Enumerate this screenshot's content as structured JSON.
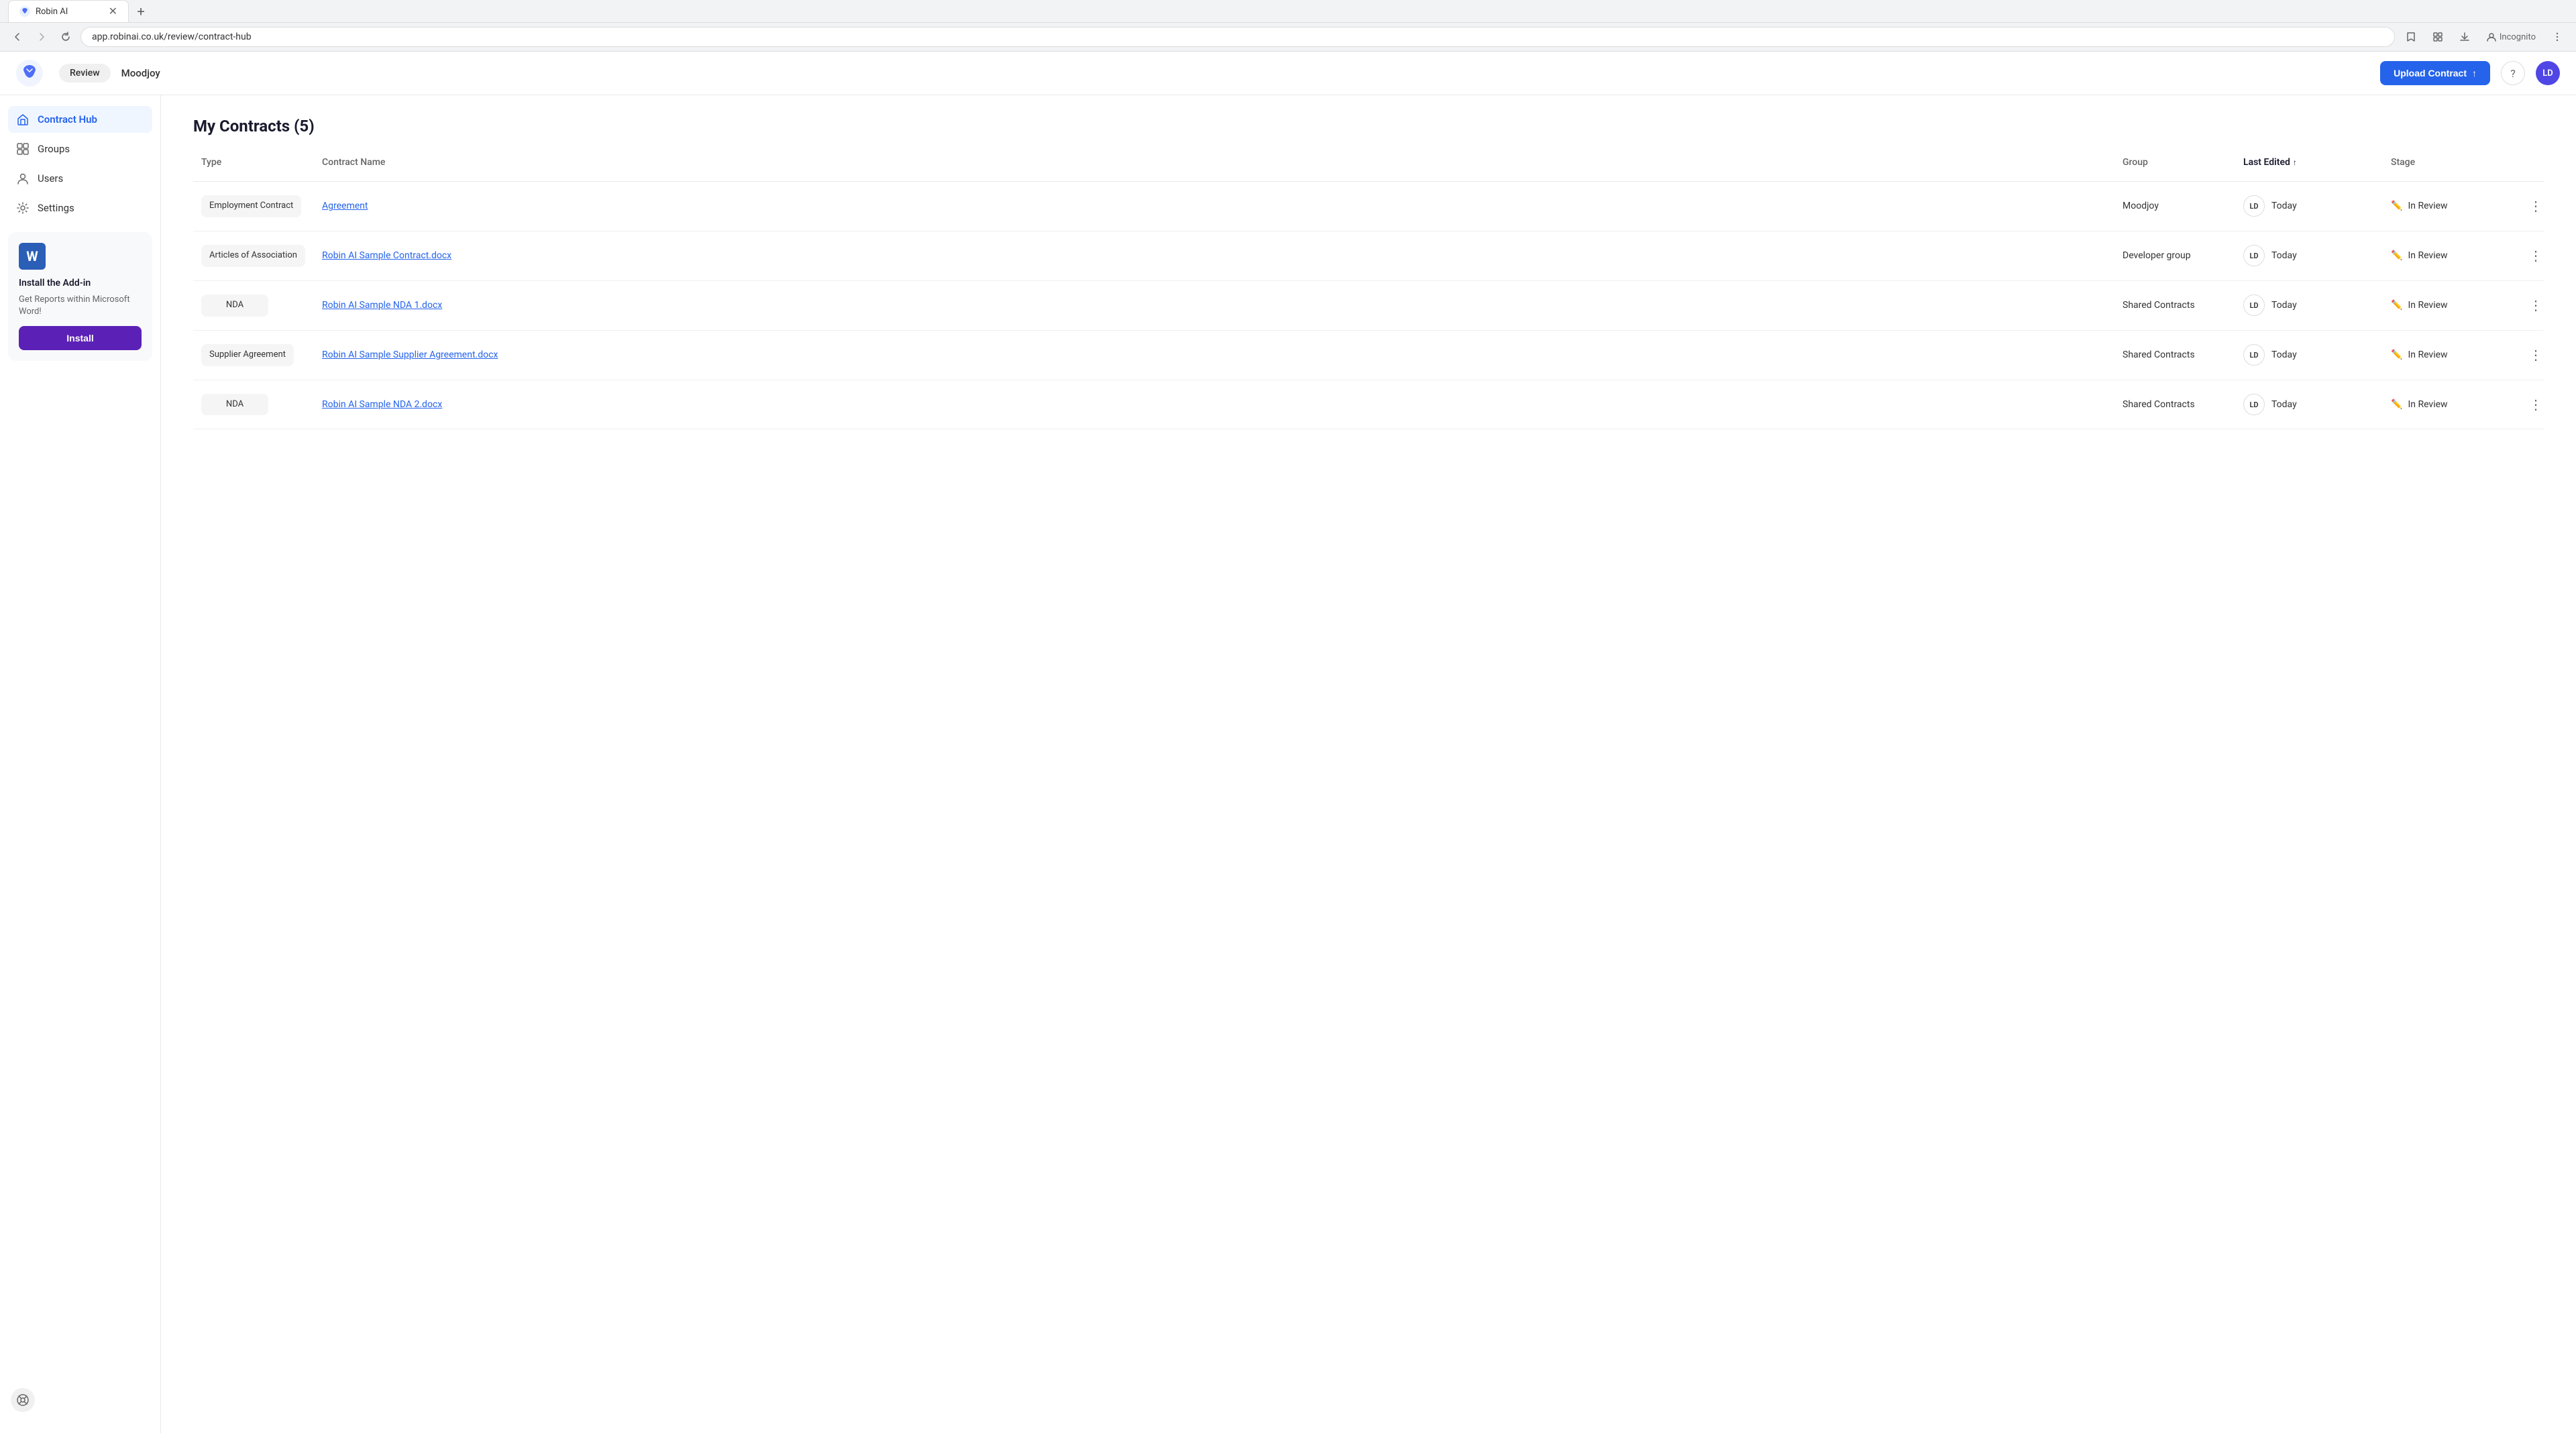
{
  "browser": {
    "tab_title": "Robin AI",
    "tab_favicon": "🐦",
    "url": "app.robinai.co.uk/review/contract-hub",
    "new_tab_icon": "+",
    "incognito_label": "Incognito"
  },
  "header": {
    "review_label": "Review",
    "company_name": "Moodjoy",
    "upload_button": "Upload Contract",
    "user_initials": "LD"
  },
  "sidebar": {
    "items": [
      {
        "id": "contract-hub",
        "label": "Contract Hub",
        "active": true
      },
      {
        "id": "groups",
        "label": "Groups",
        "active": false
      },
      {
        "id": "users",
        "label": "Users",
        "active": false
      },
      {
        "id": "settings",
        "label": "Settings",
        "active": false
      }
    ],
    "addin": {
      "title": "Install the Add-in",
      "description": "Get Reports within Microsoft Word!",
      "install_button": "Install"
    }
  },
  "page": {
    "title": "My Contracts (5)"
  },
  "table": {
    "columns": [
      {
        "id": "type",
        "label": "Type"
      },
      {
        "id": "contract_name",
        "label": "Contract Name"
      },
      {
        "id": "group",
        "label": "Group"
      },
      {
        "id": "last_edited",
        "label": "Last Edited",
        "sorted": true
      },
      {
        "id": "stage",
        "label": "Stage"
      }
    ],
    "rows": [
      {
        "type": "Employment Contract",
        "contract_name": "Agreement",
        "group": "Moodjoy",
        "avatar": "LD",
        "last_edited": "Today",
        "stage": "In Review"
      },
      {
        "type": "Articles of Association",
        "contract_name": "Robin AI Sample Contract.docx",
        "group": "Developer group",
        "avatar": "LD",
        "last_edited": "Today",
        "stage": "In Review"
      },
      {
        "type": "NDA",
        "contract_name": "Robin AI Sample NDA 1.docx",
        "group": "Shared Contracts",
        "avatar": "LD",
        "last_edited": "Today",
        "stage": "In Review"
      },
      {
        "type": "Supplier Agreement",
        "contract_name": "Robin AI Sample Supplier Agreement.docx",
        "group": "Shared Contracts",
        "avatar": "LD",
        "last_edited": "Today",
        "stage": "In Review"
      },
      {
        "type": "NDA",
        "contract_name": "Robin AI Sample NDA 2.docx",
        "group": "Shared Contracts",
        "avatar": "LD",
        "last_edited": "Today",
        "stage": "In Review"
      }
    ]
  }
}
